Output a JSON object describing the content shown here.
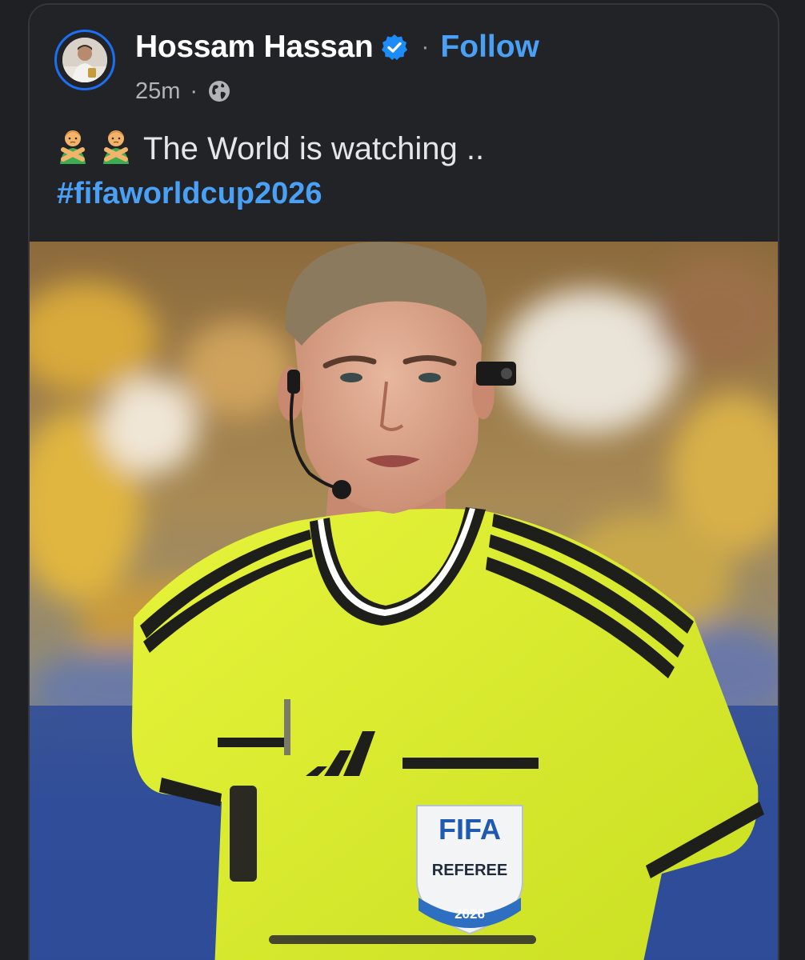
{
  "post": {
    "author_name": "Hossam Hassan",
    "verified_icon": "verified-badge-icon",
    "separator": "·",
    "follow_label": "Follow",
    "timestamp": "25m",
    "meta_separator": "·",
    "audience_icon": "globe-icon",
    "emoji_icon": "person-gesturing-no-emoji",
    "text": "The World is watching  ..",
    "hashtag": "#fifaworldcup2026"
  },
  "photo": {
    "badge_brand": "FIFA",
    "badge_role": "REFEREE",
    "badge_year": "2026"
  },
  "colors": {
    "background": "#222326",
    "link_blue": "#4aa0f5",
    "ring_blue": "#1d6ff2",
    "text_primary": "#ffffff"
  }
}
